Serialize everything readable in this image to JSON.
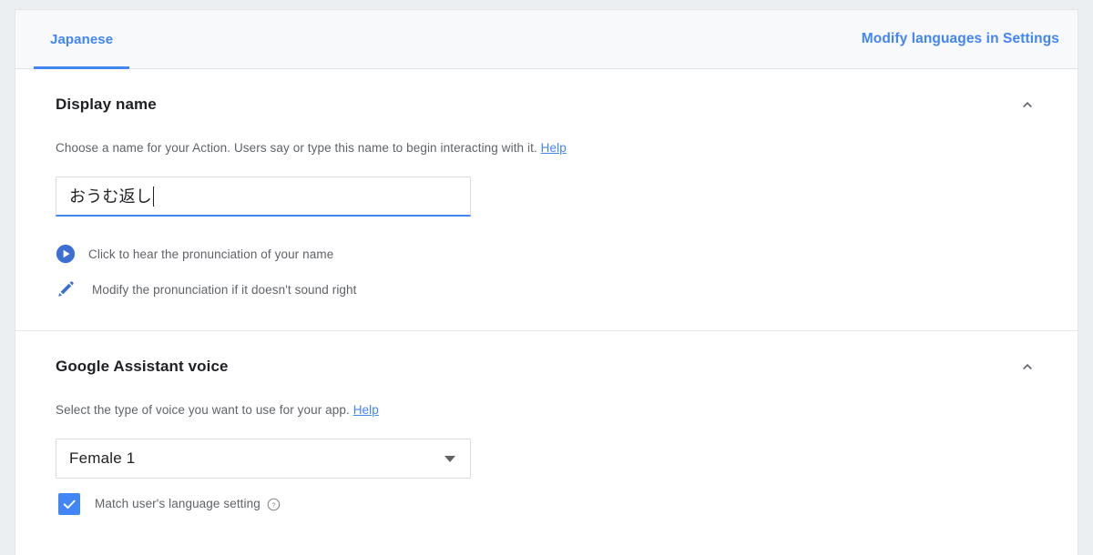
{
  "colors": {
    "accent": "#4285f4",
    "page_background": "#eceff1",
    "card_background": "#ffffff",
    "tabbar_background": "#f8f9fa",
    "text_primary": "#202124",
    "text_secondary": "#5f6368"
  },
  "tabbar": {
    "tabs": [
      {
        "label": "Japanese",
        "selected": true
      }
    ],
    "settings_link": "Modify languages in Settings"
  },
  "sections": [
    {
      "id": "display-name",
      "title": "Display name",
      "collapse_icon": "chevron-up-icon",
      "description": "Choose a name for your Action. Users say or type this name to begin interacting with it.",
      "help_label": "Help",
      "input": {
        "value": "おうむ返し",
        "placeholder": "",
        "focused": true
      },
      "actions": [
        {
          "icon": "play-circle-icon",
          "label": "Click to hear the pronunciation of your name"
        },
        {
          "icon": "pencil-icon",
          "label": "Modify the pronunciation if it doesn't sound right"
        }
      ]
    },
    {
      "id": "google-assistant-voice",
      "title": "Google Assistant voice",
      "collapse_icon": "chevron-up-icon",
      "description": "Select the type of voice you want to use for your app.",
      "help_label": "Help",
      "select": {
        "value": "Female 1",
        "options": [
          "Female 1"
        ]
      },
      "checkbox": {
        "label": "Match user's language setting",
        "checked": true,
        "help_icon": "question-circle-icon"
      }
    }
  ]
}
